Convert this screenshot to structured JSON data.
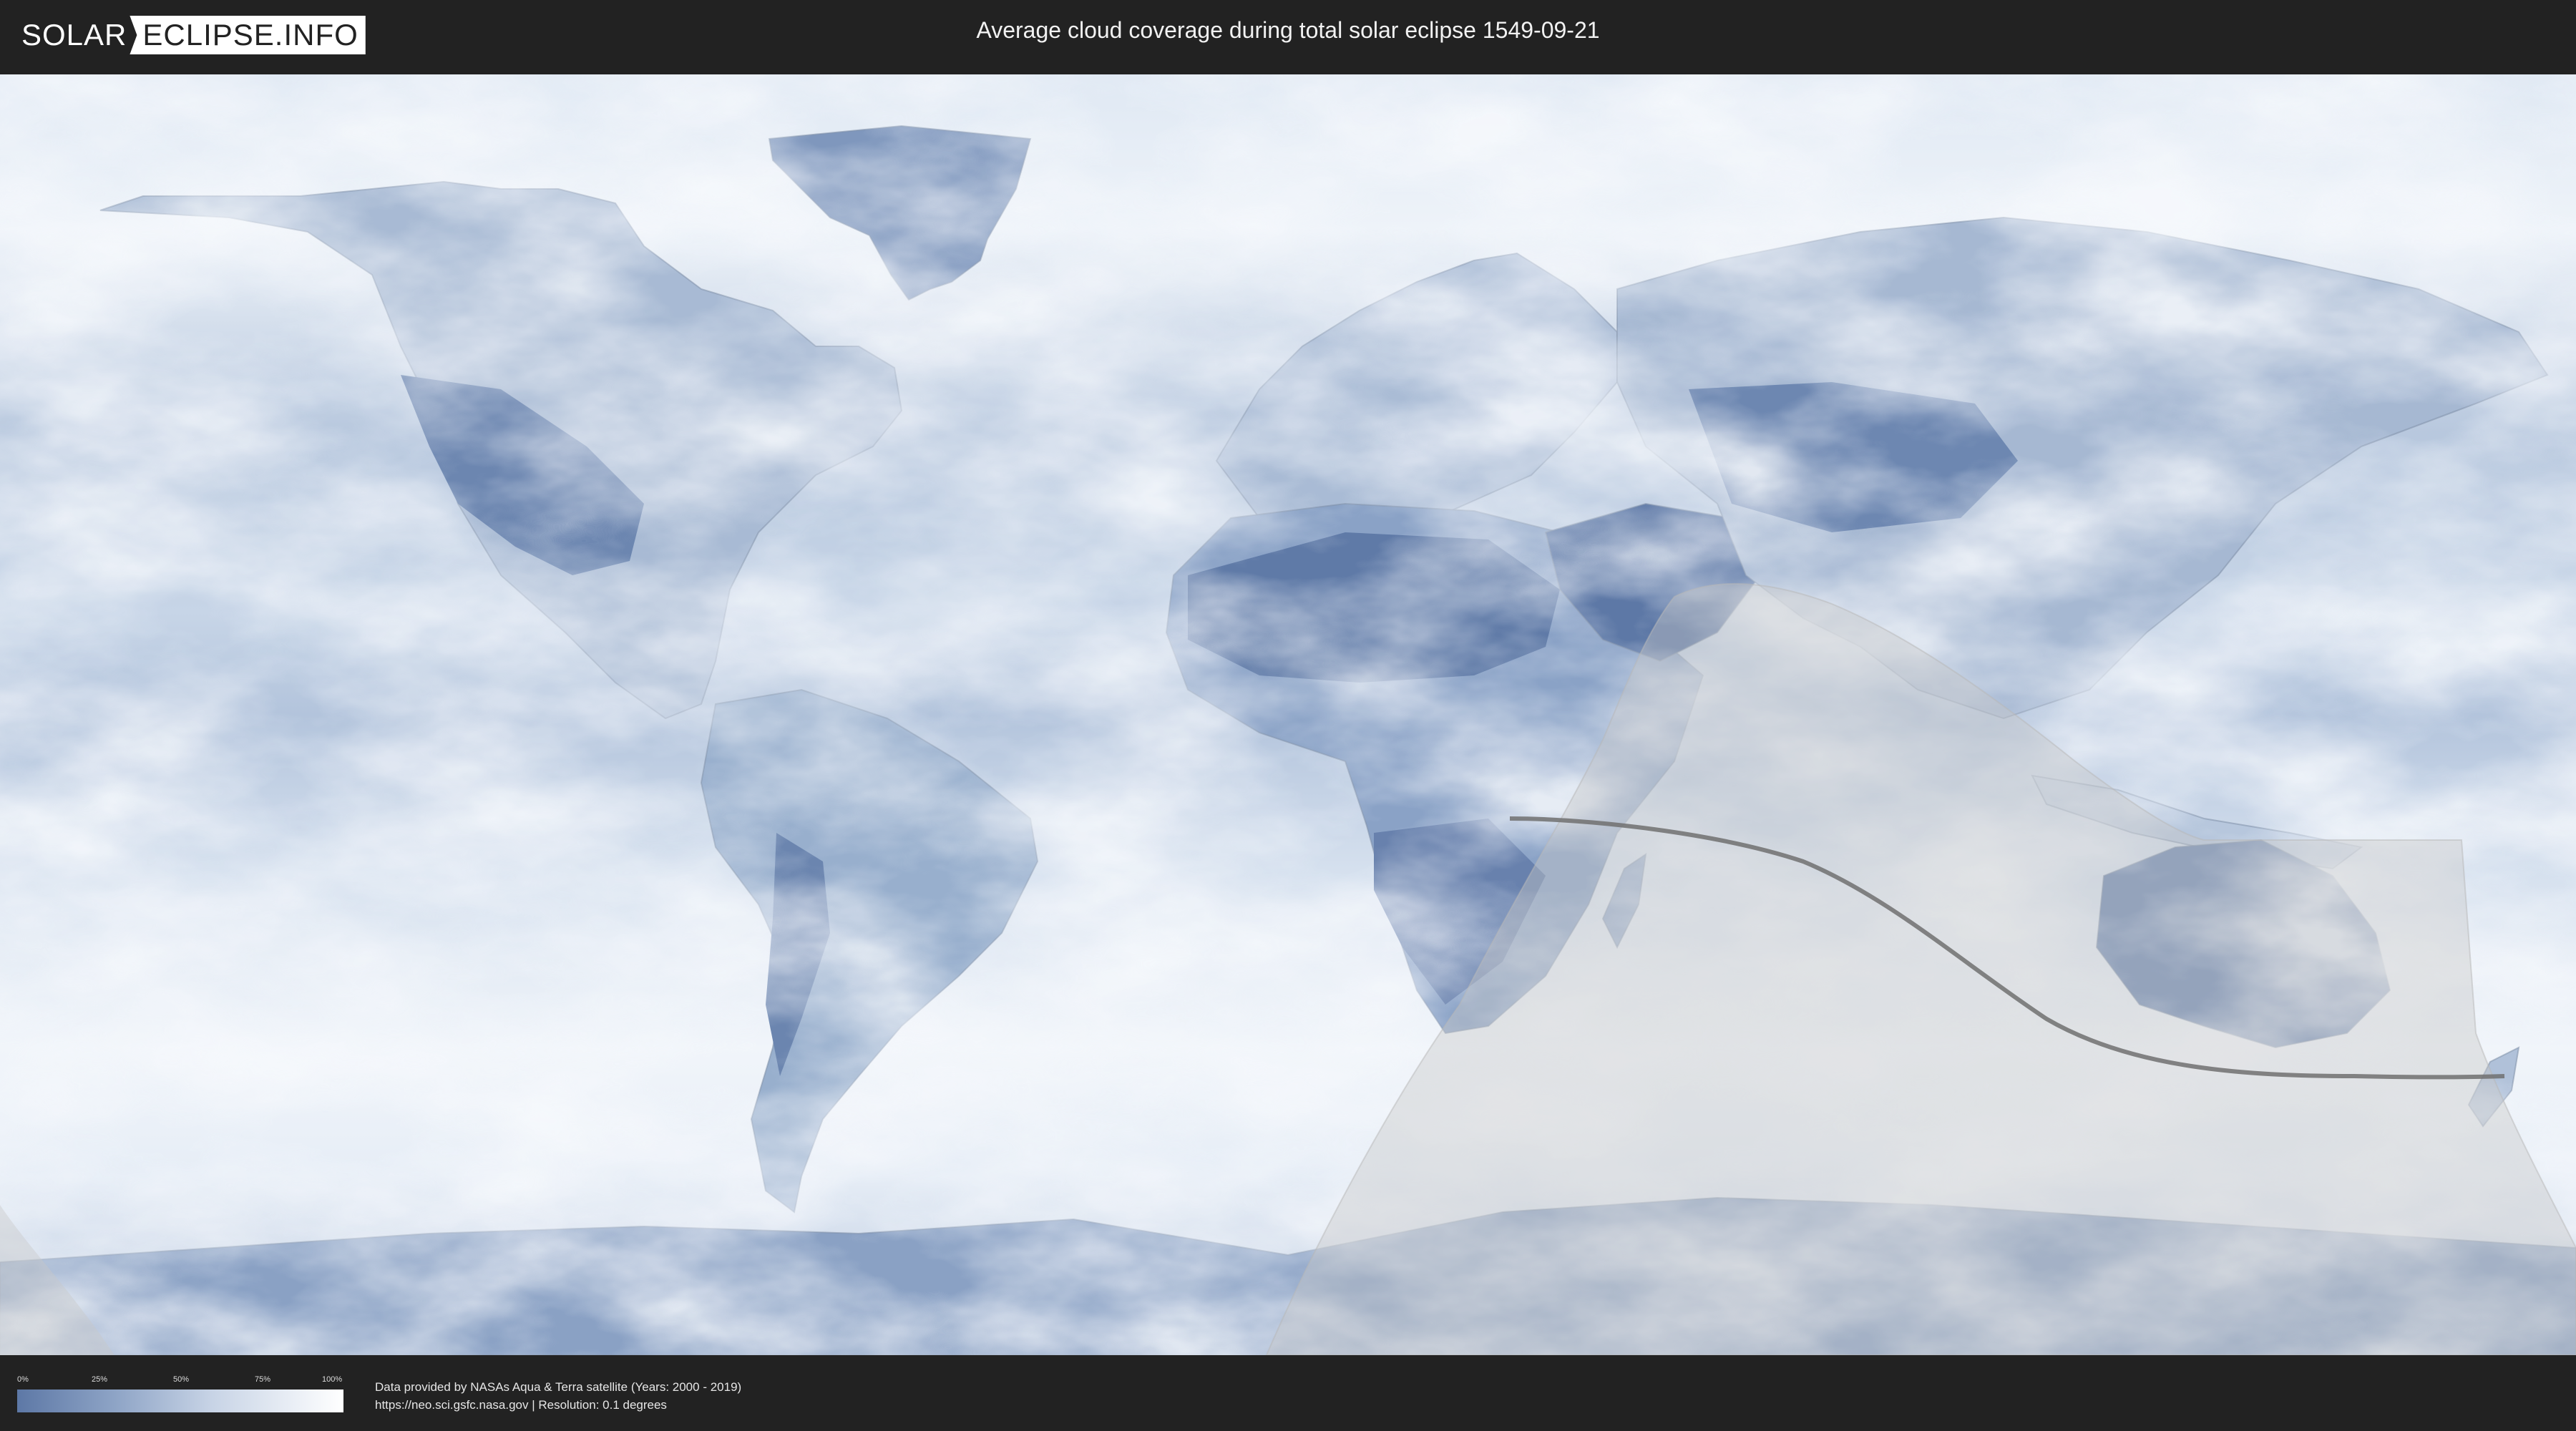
{
  "header": {
    "logo_left": "SOLAR",
    "logo_right": "ECLIPSE.INFO",
    "title": "Average cloud coverage during total solar eclipse 1549-09-21"
  },
  "colors": {
    "background": "#222222",
    "cloud_low": "#5d78a6",
    "cloud_high": "#ffffff",
    "visibility_overlay": "#c8c8c8",
    "path_of_totality": "#707070"
  },
  "legend": {
    "ticks": [
      "0%",
      "25%",
      "50%",
      "75%",
      "100%"
    ],
    "tick_values": [
      0,
      25,
      50,
      75,
      100
    ]
  },
  "footer": {
    "line1": "Data provided by NASAs Aqua & Terra satellite (Years: 2000 - 2019)",
    "line2": "https://neo.sci.gsfc.nasa.gov | Resolution: 0.1 degrees"
  },
  "map": {
    "projection": "equirectangular",
    "layers": [
      "cloud-coverage",
      "country-borders",
      "eclipse-visibility-zone",
      "path-of-totality"
    ]
  }
}
